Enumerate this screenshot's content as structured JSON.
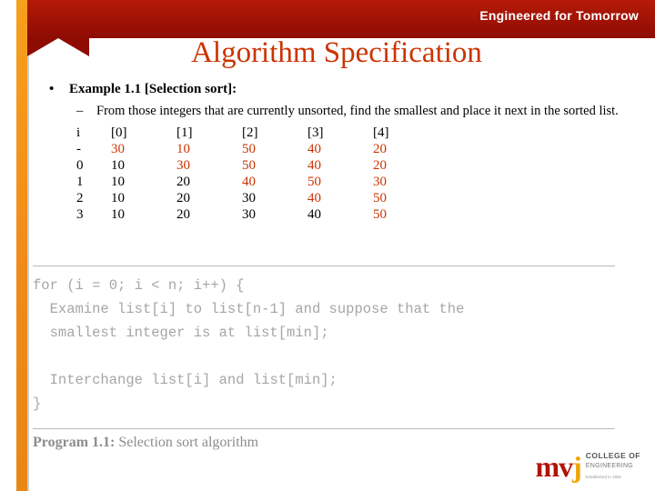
{
  "banner": {
    "tagline": "Engineered for Tomorrow"
  },
  "slide": {
    "title": "Algorithm Specification",
    "bullet_marker": "•",
    "bullet_text": "Example 1.1 [Selection sort]:",
    "sub_marker": "–",
    "sub_text": "From those integers that are currently unsorted, find the smallest and place it next in the sorted list."
  },
  "table": {
    "headers": [
      "i",
      "[0]",
      "[1]",
      "[2]",
      "[3]",
      "[4]"
    ],
    "rows": [
      {
        "i": "-",
        "cells": [
          {
            "v": "30",
            "color": "#cc3300"
          },
          {
            "v": "10",
            "color": "#cc3300"
          },
          {
            "v": "50",
            "color": "#cc3300"
          },
          {
            "v": "40",
            "color": "#cc3300"
          },
          {
            "v": "20",
            "color": "#cc3300"
          }
        ]
      },
      {
        "i": "0",
        "cells": [
          {
            "v": "10",
            "color": "#000000"
          },
          {
            "v": "30",
            "color": "#cc3300"
          },
          {
            "v": "50",
            "color": "#cc3300"
          },
          {
            "v": "40",
            "color": "#cc3300"
          },
          {
            "v": "20",
            "color": "#cc3300"
          }
        ]
      },
      {
        "i": "1",
        "cells": [
          {
            "v": "10",
            "color": "#000000"
          },
          {
            "v": "20",
            "color": "#000000"
          },
          {
            "v": "40",
            "color": "#cc3300"
          },
          {
            "v": "50",
            "color": "#cc3300"
          },
          {
            "v": "30",
            "color": "#cc3300"
          }
        ]
      },
      {
        "i": "2",
        "cells": [
          {
            "v": "10",
            "color": "#000000"
          },
          {
            "v": "20",
            "color": "#000000"
          },
          {
            "v": "30",
            "color": "#000000"
          },
          {
            "v": "40",
            "color": "#cc3300"
          },
          {
            "v": "50",
            "color": "#cc3300"
          }
        ]
      },
      {
        "i": "3",
        "cells": [
          {
            "v": "10",
            "color": "#000000"
          },
          {
            "v": "20",
            "color": "#000000"
          },
          {
            "v": "30",
            "color": "#000000"
          },
          {
            "v": "40",
            "color": "#000000"
          },
          {
            "v": "50",
            "color": "#cc3300"
          }
        ]
      }
    ]
  },
  "program": {
    "code": "for (i = 0; i < n; i++) {\n  Examine list[i] to list[n-1] and suppose that the\n  smallest integer is at list[min];\n\n  Interchange list[i] and list[min];\n}",
    "caption_label": "Program 1.1:",
    "caption_text": " Selection sort algorithm"
  },
  "logo": {
    "mark_mv": "mv",
    "mark_j": "j",
    "line1": "COLLEGE OF",
    "line2": "ENGINEERING",
    "line3": "Established in 1982"
  }
}
